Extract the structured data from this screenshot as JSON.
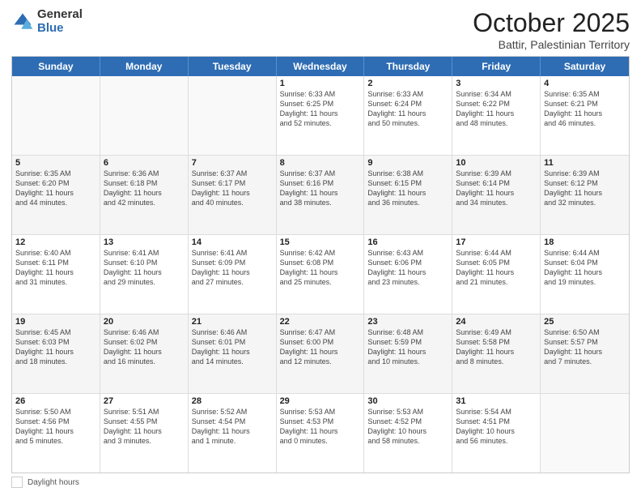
{
  "header": {
    "logo_general": "General",
    "logo_blue": "Blue",
    "title": "October 2025",
    "location": "Battir, Palestinian Territory"
  },
  "days_of_week": [
    "Sunday",
    "Monday",
    "Tuesday",
    "Wednesday",
    "Thursday",
    "Friday",
    "Saturday"
  ],
  "footer_label": "Daylight hours",
  "weeks": [
    [
      {
        "num": "",
        "info": ""
      },
      {
        "num": "",
        "info": ""
      },
      {
        "num": "",
        "info": ""
      },
      {
        "num": "1",
        "info": "Sunrise: 6:33 AM\nSunset: 6:25 PM\nDaylight: 11 hours\nand 52 minutes."
      },
      {
        "num": "2",
        "info": "Sunrise: 6:33 AM\nSunset: 6:24 PM\nDaylight: 11 hours\nand 50 minutes."
      },
      {
        "num": "3",
        "info": "Sunrise: 6:34 AM\nSunset: 6:22 PM\nDaylight: 11 hours\nand 48 minutes."
      },
      {
        "num": "4",
        "info": "Sunrise: 6:35 AM\nSunset: 6:21 PM\nDaylight: 11 hours\nand 46 minutes."
      }
    ],
    [
      {
        "num": "5",
        "info": "Sunrise: 6:35 AM\nSunset: 6:20 PM\nDaylight: 11 hours\nand 44 minutes."
      },
      {
        "num": "6",
        "info": "Sunrise: 6:36 AM\nSunset: 6:18 PM\nDaylight: 11 hours\nand 42 minutes."
      },
      {
        "num": "7",
        "info": "Sunrise: 6:37 AM\nSunset: 6:17 PM\nDaylight: 11 hours\nand 40 minutes."
      },
      {
        "num": "8",
        "info": "Sunrise: 6:37 AM\nSunset: 6:16 PM\nDaylight: 11 hours\nand 38 minutes."
      },
      {
        "num": "9",
        "info": "Sunrise: 6:38 AM\nSunset: 6:15 PM\nDaylight: 11 hours\nand 36 minutes."
      },
      {
        "num": "10",
        "info": "Sunrise: 6:39 AM\nSunset: 6:14 PM\nDaylight: 11 hours\nand 34 minutes."
      },
      {
        "num": "11",
        "info": "Sunrise: 6:39 AM\nSunset: 6:12 PM\nDaylight: 11 hours\nand 32 minutes."
      }
    ],
    [
      {
        "num": "12",
        "info": "Sunrise: 6:40 AM\nSunset: 6:11 PM\nDaylight: 11 hours\nand 31 minutes."
      },
      {
        "num": "13",
        "info": "Sunrise: 6:41 AM\nSunset: 6:10 PM\nDaylight: 11 hours\nand 29 minutes."
      },
      {
        "num": "14",
        "info": "Sunrise: 6:41 AM\nSunset: 6:09 PM\nDaylight: 11 hours\nand 27 minutes."
      },
      {
        "num": "15",
        "info": "Sunrise: 6:42 AM\nSunset: 6:08 PM\nDaylight: 11 hours\nand 25 minutes."
      },
      {
        "num": "16",
        "info": "Sunrise: 6:43 AM\nSunset: 6:06 PM\nDaylight: 11 hours\nand 23 minutes."
      },
      {
        "num": "17",
        "info": "Sunrise: 6:44 AM\nSunset: 6:05 PM\nDaylight: 11 hours\nand 21 minutes."
      },
      {
        "num": "18",
        "info": "Sunrise: 6:44 AM\nSunset: 6:04 PM\nDaylight: 11 hours\nand 19 minutes."
      }
    ],
    [
      {
        "num": "19",
        "info": "Sunrise: 6:45 AM\nSunset: 6:03 PM\nDaylight: 11 hours\nand 18 minutes."
      },
      {
        "num": "20",
        "info": "Sunrise: 6:46 AM\nSunset: 6:02 PM\nDaylight: 11 hours\nand 16 minutes."
      },
      {
        "num": "21",
        "info": "Sunrise: 6:46 AM\nSunset: 6:01 PM\nDaylight: 11 hours\nand 14 minutes."
      },
      {
        "num": "22",
        "info": "Sunrise: 6:47 AM\nSunset: 6:00 PM\nDaylight: 11 hours\nand 12 minutes."
      },
      {
        "num": "23",
        "info": "Sunrise: 6:48 AM\nSunset: 5:59 PM\nDaylight: 11 hours\nand 10 minutes."
      },
      {
        "num": "24",
        "info": "Sunrise: 6:49 AM\nSunset: 5:58 PM\nDaylight: 11 hours\nand 8 minutes."
      },
      {
        "num": "25",
        "info": "Sunrise: 6:50 AM\nSunset: 5:57 PM\nDaylight: 11 hours\nand 7 minutes."
      }
    ],
    [
      {
        "num": "26",
        "info": "Sunrise: 5:50 AM\nSunset: 4:56 PM\nDaylight: 11 hours\nand 5 minutes."
      },
      {
        "num": "27",
        "info": "Sunrise: 5:51 AM\nSunset: 4:55 PM\nDaylight: 11 hours\nand 3 minutes."
      },
      {
        "num": "28",
        "info": "Sunrise: 5:52 AM\nSunset: 4:54 PM\nDaylight: 11 hours\nand 1 minute."
      },
      {
        "num": "29",
        "info": "Sunrise: 5:53 AM\nSunset: 4:53 PM\nDaylight: 11 hours\nand 0 minutes."
      },
      {
        "num": "30",
        "info": "Sunrise: 5:53 AM\nSunset: 4:52 PM\nDaylight: 10 hours\nand 58 minutes."
      },
      {
        "num": "31",
        "info": "Sunrise: 5:54 AM\nSunset: 4:51 PM\nDaylight: 10 hours\nand 56 minutes."
      },
      {
        "num": "",
        "info": ""
      }
    ]
  ]
}
